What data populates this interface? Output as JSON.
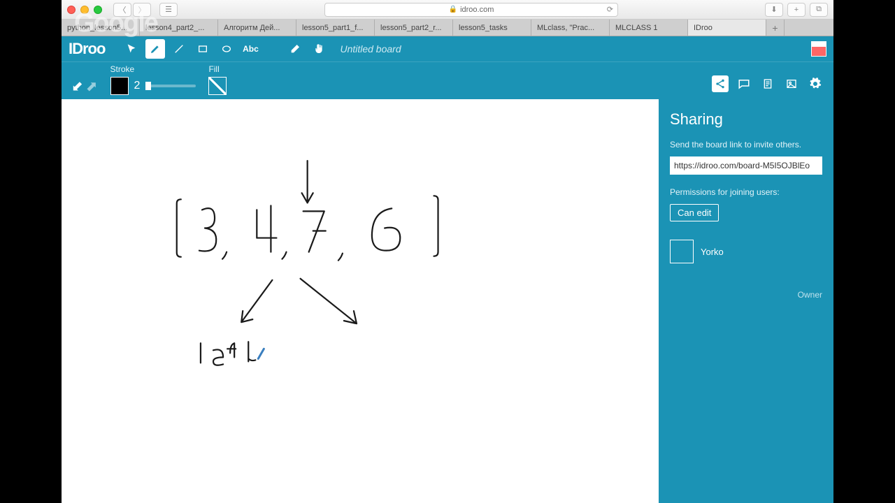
{
  "browser": {
    "url_host": "idroo.com",
    "tabs": [
      "python_lesson5...",
      "lesson4_part2_...",
      "Алгоритм Дей...",
      "lesson5_part1_f...",
      "lesson5_part2_r...",
      "lesson5_tasks",
      "MLclass, \"Prac...",
      "MLCLASS 1",
      "IDroo"
    ],
    "active_tab_index": 8,
    "watermark": "Google"
  },
  "app": {
    "logo": "IDroo",
    "board_title": "Untitled board",
    "toolbar": {
      "stroke_label": "Stroke",
      "stroke_value": "2",
      "fill_label": "Fill",
      "text_tool_label": "Abc"
    },
    "right_icons": [
      "share",
      "chat",
      "clipboard",
      "image",
      "settings"
    ]
  },
  "sharing": {
    "title": "Sharing",
    "hint": "Send the board link to invite others.",
    "link": "https://idroo.com/board-M5I5OJBlEo",
    "perm_label": "Permissions for joining users:",
    "perm_value": "Can edit",
    "user": "Yorko",
    "role": "Owner"
  },
  "drawing": {
    "array": [
      "3",
      "4",
      "7",
      "6"
    ],
    "left_label": "left"
  }
}
